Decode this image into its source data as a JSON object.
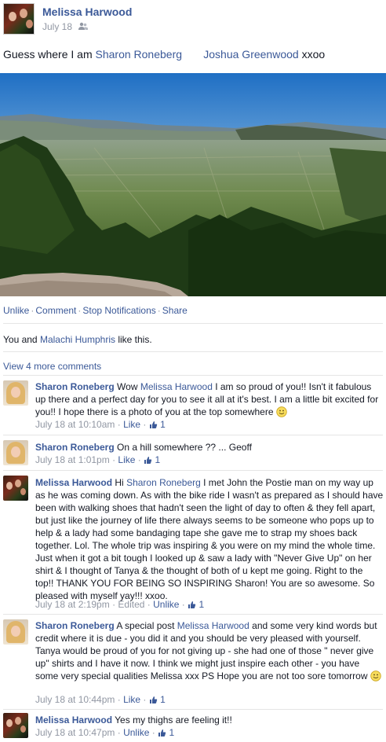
{
  "post": {
    "author": "Melissa Harwood",
    "date": "July 18",
    "text_prefix": "Guess where I am",
    "tag1": "Sharon Roneberg",
    "tag2": "Joshua Greenwood",
    "text_suffix": "xxoo"
  },
  "actions": {
    "unlike": "Unlike",
    "comment": "Comment",
    "stop_notifications": "Stop Notifications",
    "share": "Share",
    "separator": "·"
  },
  "likes": {
    "you_and": "You and",
    "other": "Malachi Humphris",
    "suffix": "like this."
  },
  "more_comments": "View 4 more comments",
  "comments": [
    {
      "author": "Sharon Roneberg",
      "text_1": "Wow",
      "mention": "Melissa Harwood",
      "text_2": "I am so proud of you!! Isn't it fabulous up there and a perfect day for you to see it all at it's best. I am a little bit excited for you!! I hope there is a photo of you at the top somewhere",
      "time": "July 18 at 10:10am",
      "action": "Like",
      "like_count": "1"
    },
    {
      "author": "Sharon Roneberg",
      "text_1": "On a hill somewhere ?? ... Geoff",
      "time": "July 18 at 1:01pm",
      "action": "Like",
      "like_count": "1"
    },
    {
      "author": "Melissa Harwood",
      "text_1": "Hi",
      "mention": "Sharon Roneberg",
      "text_2": "I met John the Postie man on my way up as he was coming down. As with the bike ride I wasn't as prepared as I should have been with walking shoes that hadn't seen the light of day to often & they fell apart, but just like the journey of life there always seems to be someone who pops up to help & a lady had some bandaging tape she gave me to strap my shoes back together. Lol. The whole trip was inspiring & you were on my mind the whole time. Just when it got a bit tough I looked up & saw a lady with \"Never Give Up\" on her shirt & I thought of Tanya & the thought of both of u kept me going. Right to the top!! THANK YOU FOR BEING SO INSPIRING Sharon! You are so awesome. So pleased with myself yay!!! xxoo.",
      "time": "July 18 at 2:19pm",
      "edited": "Edited",
      "action": "Unlike",
      "like_count": "1"
    },
    {
      "author": "Sharon Roneberg",
      "text_1": "A special post",
      "mention": "Melissa Harwood",
      "text_2": "and some very kind words but credit where it is due - you did it and you should be very pleased with yourself. Tanya would be proud of you for not giving up - she had one of those \" never give up\" shirts and I have it now. I think we might just inspire each other - you have some very special qualities Melissa xxx PS Hope you are not too sore tomorrow",
      "time": "July 18 at 10:44pm",
      "action": "Like",
      "like_count": "1"
    },
    {
      "author": "Melissa Harwood",
      "text_1": "Yes my thighs are feeling it!!",
      "time": "July 18 at 10:47pm",
      "action": "Unlike",
      "like_count": "1"
    }
  ],
  "colors": {
    "link": "#3b5998",
    "meta": "#9197a3",
    "text": "#141823",
    "divider": "#e5e5e5"
  }
}
